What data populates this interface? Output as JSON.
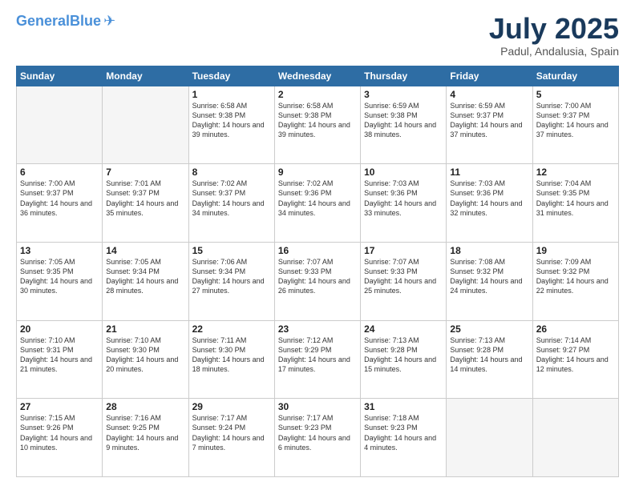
{
  "header": {
    "logo_line1": "General",
    "logo_line2": "Blue",
    "month": "July 2025",
    "location": "Padul, Andalusia, Spain"
  },
  "days_of_week": [
    "Sunday",
    "Monday",
    "Tuesday",
    "Wednesday",
    "Thursday",
    "Friday",
    "Saturday"
  ],
  "weeks": [
    [
      {
        "day": "",
        "sunrise": "",
        "sunset": "",
        "daylight": ""
      },
      {
        "day": "",
        "sunrise": "",
        "sunset": "",
        "daylight": ""
      },
      {
        "day": "1",
        "sunrise": "Sunrise: 6:58 AM",
        "sunset": "Sunset: 9:38 PM",
        "daylight": "Daylight: 14 hours and 39 minutes."
      },
      {
        "day": "2",
        "sunrise": "Sunrise: 6:58 AM",
        "sunset": "Sunset: 9:38 PM",
        "daylight": "Daylight: 14 hours and 39 minutes."
      },
      {
        "day": "3",
        "sunrise": "Sunrise: 6:59 AM",
        "sunset": "Sunset: 9:38 PM",
        "daylight": "Daylight: 14 hours and 38 minutes."
      },
      {
        "day": "4",
        "sunrise": "Sunrise: 6:59 AM",
        "sunset": "Sunset: 9:37 PM",
        "daylight": "Daylight: 14 hours and 37 minutes."
      },
      {
        "day": "5",
        "sunrise": "Sunrise: 7:00 AM",
        "sunset": "Sunset: 9:37 PM",
        "daylight": "Daylight: 14 hours and 37 minutes."
      }
    ],
    [
      {
        "day": "6",
        "sunrise": "Sunrise: 7:00 AM",
        "sunset": "Sunset: 9:37 PM",
        "daylight": "Daylight: 14 hours and 36 minutes."
      },
      {
        "day": "7",
        "sunrise": "Sunrise: 7:01 AM",
        "sunset": "Sunset: 9:37 PM",
        "daylight": "Daylight: 14 hours and 35 minutes."
      },
      {
        "day": "8",
        "sunrise": "Sunrise: 7:02 AM",
        "sunset": "Sunset: 9:37 PM",
        "daylight": "Daylight: 14 hours and 34 minutes."
      },
      {
        "day": "9",
        "sunrise": "Sunrise: 7:02 AM",
        "sunset": "Sunset: 9:36 PM",
        "daylight": "Daylight: 14 hours and 34 minutes."
      },
      {
        "day": "10",
        "sunrise": "Sunrise: 7:03 AM",
        "sunset": "Sunset: 9:36 PM",
        "daylight": "Daylight: 14 hours and 33 minutes."
      },
      {
        "day": "11",
        "sunrise": "Sunrise: 7:03 AM",
        "sunset": "Sunset: 9:36 PM",
        "daylight": "Daylight: 14 hours and 32 minutes."
      },
      {
        "day": "12",
        "sunrise": "Sunrise: 7:04 AM",
        "sunset": "Sunset: 9:35 PM",
        "daylight": "Daylight: 14 hours and 31 minutes."
      }
    ],
    [
      {
        "day": "13",
        "sunrise": "Sunrise: 7:05 AM",
        "sunset": "Sunset: 9:35 PM",
        "daylight": "Daylight: 14 hours and 30 minutes."
      },
      {
        "day": "14",
        "sunrise": "Sunrise: 7:05 AM",
        "sunset": "Sunset: 9:34 PM",
        "daylight": "Daylight: 14 hours and 28 minutes."
      },
      {
        "day": "15",
        "sunrise": "Sunrise: 7:06 AM",
        "sunset": "Sunset: 9:34 PM",
        "daylight": "Daylight: 14 hours and 27 minutes."
      },
      {
        "day": "16",
        "sunrise": "Sunrise: 7:07 AM",
        "sunset": "Sunset: 9:33 PM",
        "daylight": "Daylight: 14 hours and 26 minutes."
      },
      {
        "day": "17",
        "sunrise": "Sunrise: 7:07 AM",
        "sunset": "Sunset: 9:33 PM",
        "daylight": "Daylight: 14 hours and 25 minutes."
      },
      {
        "day": "18",
        "sunrise": "Sunrise: 7:08 AM",
        "sunset": "Sunset: 9:32 PM",
        "daylight": "Daylight: 14 hours and 24 minutes."
      },
      {
        "day": "19",
        "sunrise": "Sunrise: 7:09 AM",
        "sunset": "Sunset: 9:32 PM",
        "daylight": "Daylight: 14 hours and 22 minutes."
      }
    ],
    [
      {
        "day": "20",
        "sunrise": "Sunrise: 7:10 AM",
        "sunset": "Sunset: 9:31 PM",
        "daylight": "Daylight: 14 hours and 21 minutes."
      },
      {
        "day": "21",
        "sunrise": "Sunrise: 7:10 AM",
        "sunset": "Sunset: 9:30 PM",
        "daylight": "Daylight: 14 hours and 20 minutes."
      },
      {
        "day": "22",
        "sunrise": "Sunrise: 7:11 AM",
        "sunset": "Sunset: 9:30 PM",
        "daylight": "Daylight: 14 hours and 18 minutes."
      },
      {
        "day": "23",
        "sunrise": "Sunrise: 7:12 AM",
        "sunset": "Sunset: 9:29 PM",
        "daylight": "Daylight: 14 hours and 17 minutes."
      },
      {
        "day": "24",
        "sunrise": "Sunrise: 7:13 AM",
        "sunset": "Sunset: 9:28 PM",
        "daylight": "Daylight: 14 hours and 15 minutes."
      },
      {
        "day": "25",
        "sunrise": "Sunrise: 7:13 AM",
        "sunset": "Sunset: 9:28 PM",
        "daylight": "Daylight: 14 hours and 14 minutes."
      },
      {
        "day": "26",
        "sunrise": "Sunrise: 7:14 AM",
        "sunset": "Sunset: 9:27 PM",
        "daylight": "Daylight: 14 hours and 12 minutes."
      }
    ],
    [
      {
        "day": "27",
        "sunrise": "Sunrise: 7:15 AM",
        "sunset": "Sunset: 9:26 PM",
        "daylight": "Daylight: 14 hours and 10 minutes."
      },
      {
        "day": "28",
        "sunrise": "Sunrise: 7:16 AM",
        "sunset": "Sunset: 9:25 PM",
        "daylight": "Daylight: 14 hours and 9 minutes."
      },
      {
        "day": "29",
        "sunrise": "Sunrise: 7:17 AM",
        "sunset": "Sunset: 9:24 PM",
        "daylight": "Daylight: 14 hours and 7 minutes."
      },
      {
        "day": "30",
        "sunrise": "Sunrise: 7:17 AM",
        "sunset": "Sunset: 9:23 PM",
        "daylight": "Daylight: 14 hours and 6 minutes."
      },
      {
        "day": "31",
        "sunrise": "Sunrise: 7:18 AM",
        "sunset": "Sunset: 9:23 PM",
        "daylight": "Daylight: 14 hours and 4 minutes."
      },
      {
        "day": "",
        "sunrise": "",
        "sunset": "",
        "daylight": ""
      },
      {
        "day": "",
        "sunrise": "",
        "sunset": "",
        "daylight": ""
      }
    ]
  ]
}
